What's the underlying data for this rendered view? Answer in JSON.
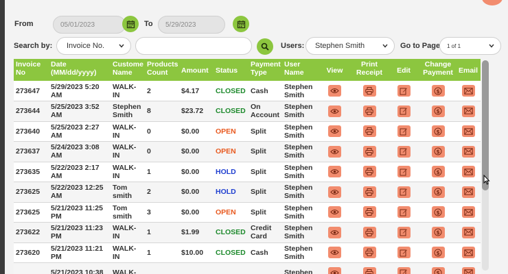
{
  "filters": {
    "from_label": "From",
    "from_value": "05/01/2023",
    "to_label": "To",
    "to_value": "5/29/2023",
    "search_by_label": "Search by:",
    "search_by_value": "Invoice No.",
    "search_value": "",
    "users_label": "Users:",
    "users_value": "Stephen Smith",
    "goto_label": "Go to Page",
    "goto_value": "1 of 1"
  },
  "table": {
    "headers": {
      "invoice": "Invoice No",
      "date": "Date (MM/dd/yyyy)",
      "customer": "Custome Name",
      "products": "Products Count",
      "amount": "Amount",
      "status": "Status",
      "payment": "Payment Type",
      "user": "User Name",
      "view": "View",
      "print": "Print Receipt",
      "edit": "Edit",
      "change_payment": "Change Payment",
      "email": "Email"
    },
    "rows": [
      {
        "invoice": "273647",
        "date": "5/29/2023 5:20 AM",
        "customer": "WALK-IN",
        "count": "2",
        "amount": "$4.17",
        "status": "CLOSED",
        "payment": "Cash",
        "user": "Stephen Smith"
      },
      {
        "invoice": "273644",
        "date": "5/25/2023 3:52 AM",
        "customer": "Stephen Smith",
        "count": "8",
        "amount": "$23.72",
        "status": "CLOSED",
        "payment": "On Account",
        "user": "Stephen Smith"
      },
      {
        "invoice": "273640",
        "date": "5/25/2023 2:27 AM",
        "customer": "WALK-IN",
        "count": "0",
        "amount": "$0.00",
        "status": "OPEN",
        "payment": "Split",
        "user": "Stephen Smith"
      },
      {
        "invoice": "273637",
        "date": "5/24/2023 3:08 AM",
        "customer": "WALK-IN",
        "count": "0",
        "amount": "$0.00",
        "status": "OPEN",
        "payment": "Split",
        "user": "Stephen Smith"
      },
      {
        "invoice": "273635",
        "date": "5/22/2023 2:17 AM",
        "customer": "WALK-IN",
        "count": "1",
        "amount": "$0.00",
        "status": "HOLD",
        "payment": "Split",
        "user": "Stephen Smith"
      },
      {
        "invoice": "273625",
        "date": "5/22/2023 12:25 AM",
        "customer": "Tom smith",
        "count": "2",
        "amount": "$0.00",
        "status": "HOLD",
        "payment": "Split",
        "user": "Stephen Smith"
      },
      {
        "invoice": "273625",
        "date": "5/21/2023 11:25 PM",
        "customer": "Tom smith",
        "count": "3",
        "amount": "$0.00",
        "status": "OPEN",
        "payment": "Split",
        "user": "Stephen Smith"
      },
      {
        "invoice": "273622",
        "date": "5/21/2023 11:23 PM",
        "customer": "WALK-IN",
        "count": "1",
        "amount": "$1.99",
        "status": "CLOSED",
        "payment": "Credit Card",
        "user": "Stephen Smith"
      },
      {
        "invoice": "273620",
        "date": "5/21/2023 11:21 PM",
        "customer": "WALK-IN",
        "count": "1",
        "amount": "$10.00",
        "status": "CLOSED",
        "payment": "Cash",
        "user": "Stephen Smith"
      },
      {
        "invoice": "",
        "date": "5/21/2023 10:38",
        "customer": "WALK-",
        "count": "",
        "amount": "",
        "status": "",
        "payment": "",
        "user": "Stephen"
      }
    ]
  },
  "icons": {
    "calendar": "calendar-icon",
    "search": "search-icon",
    "view": "eye-icon",
    "print": "printer-icon",
    "edit": "edit-icon",
    "change_payment": "payment-change-icon",
    "email": "envelope-icon"
  },
  "colors": {
    "accent_green": "#8cc63f",
    "action_orange": "#f28c6e",
    "status_closed": "#1e8a2d",
    "status_open": "#e8591f",
    "status_hold": "#1f3fd0"
  }
}
